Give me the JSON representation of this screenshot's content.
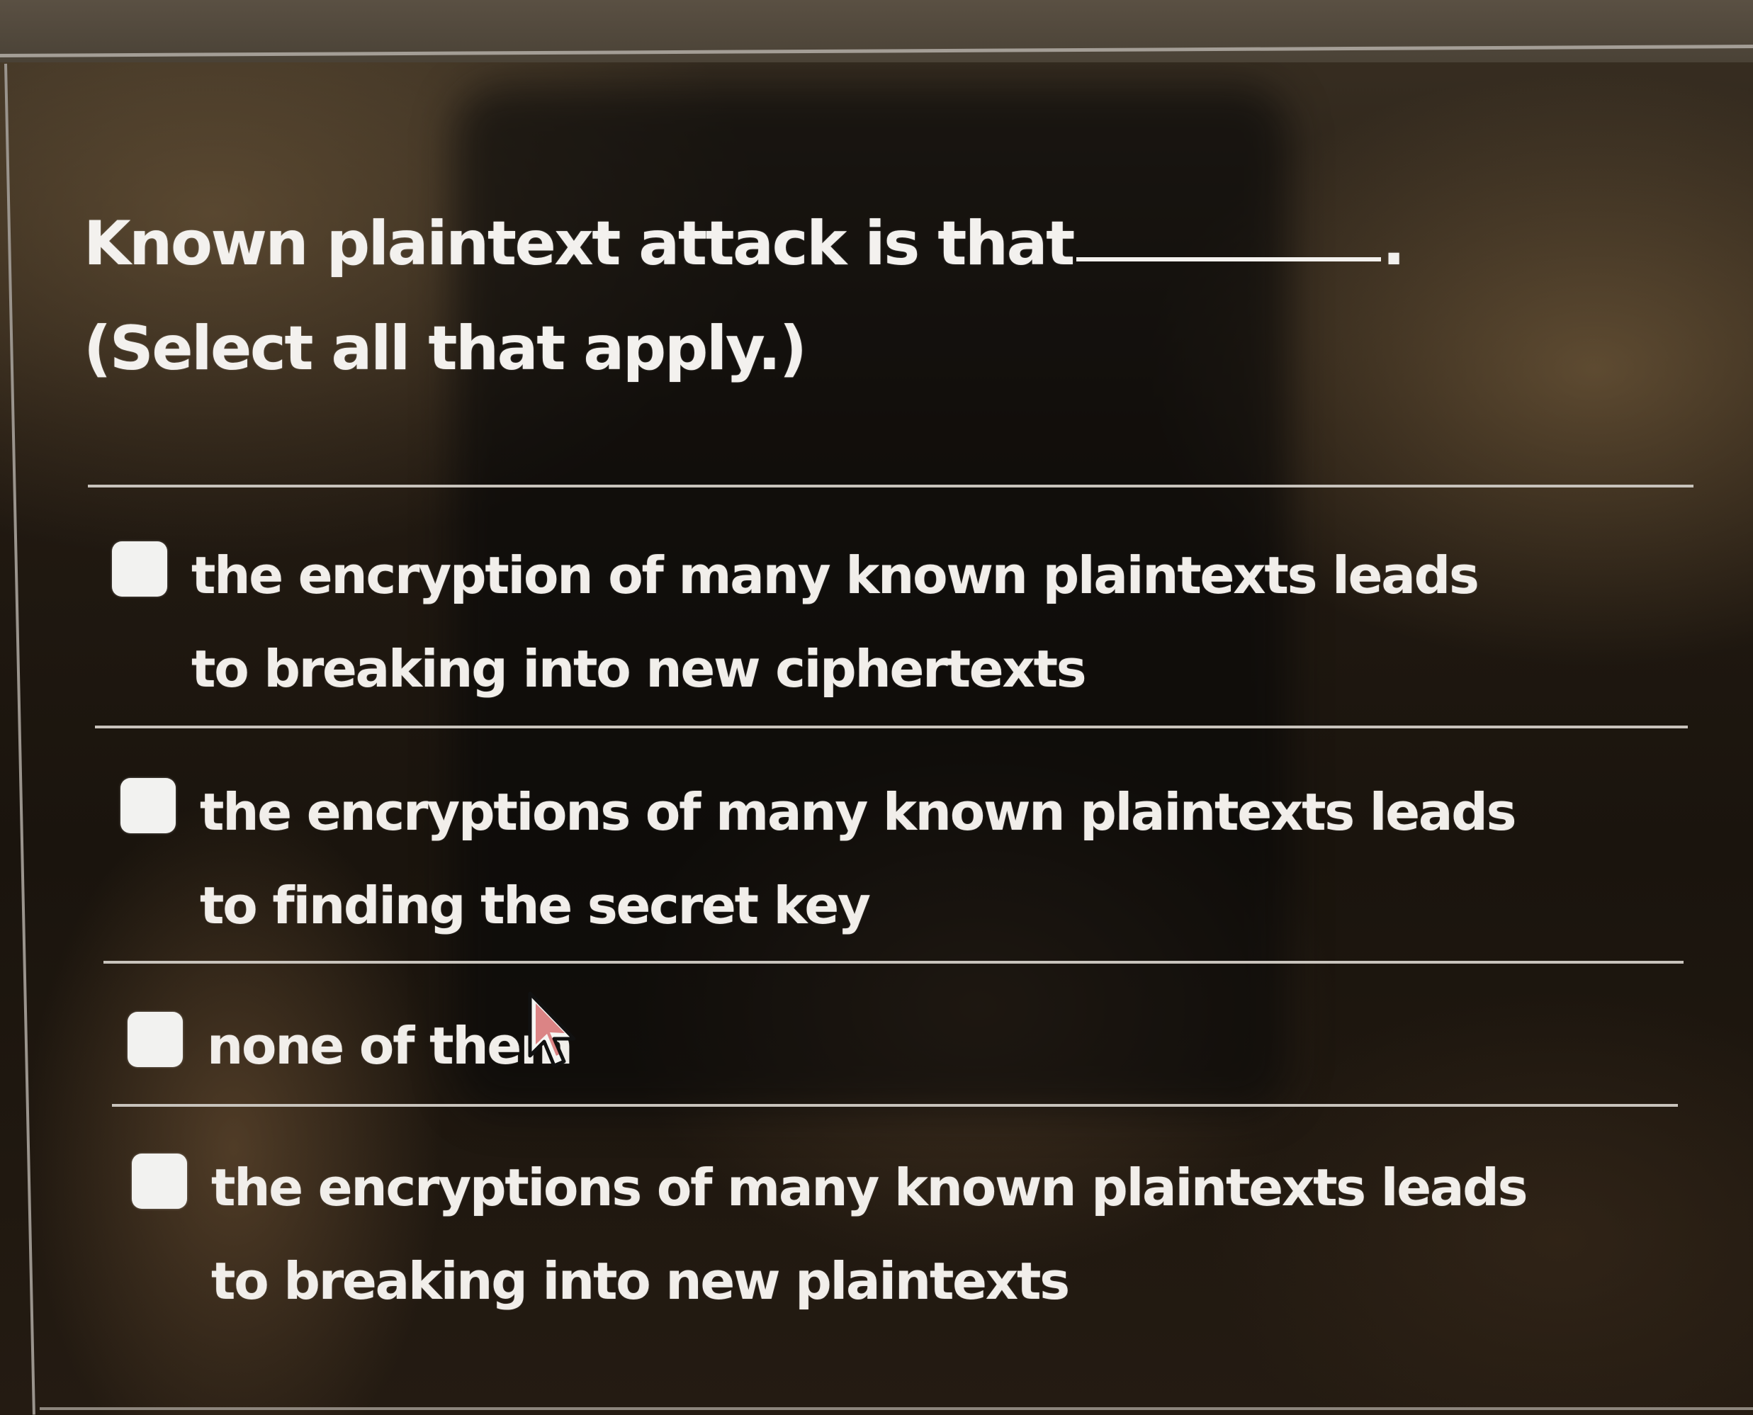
{
  "question": {
    "text_before": "Known plaintext attack is that",
    "text_after": ". (Select all that apply.)"
  },
  "options": [
    {
      "label": "the encryption of many known plaintexts leads to breaking into new ciphertexts",
      "checked": false
    },
    {
      "label": "the encryptions of many known plaintexts leads to finding the secret key",
      "checked": false
    },
    {
      "label": "none of them",
      "checked": false
    },
    {
      "label": "the encryptions of many known plaintexts leads to breaking into new plaintexts",
      "checked": false
    }
  ],
  "icons": {
    "cursor": "mouse-pointer-icon",
    "checkbox": "checkbox-unchecked-icon"
  },
  "colors": {
    "text": "#f1eeea",
    "checkbox": "#f2f2f0",
    "divider": "#c8c3bc",
    "background": "#1a140d"
  }
}
